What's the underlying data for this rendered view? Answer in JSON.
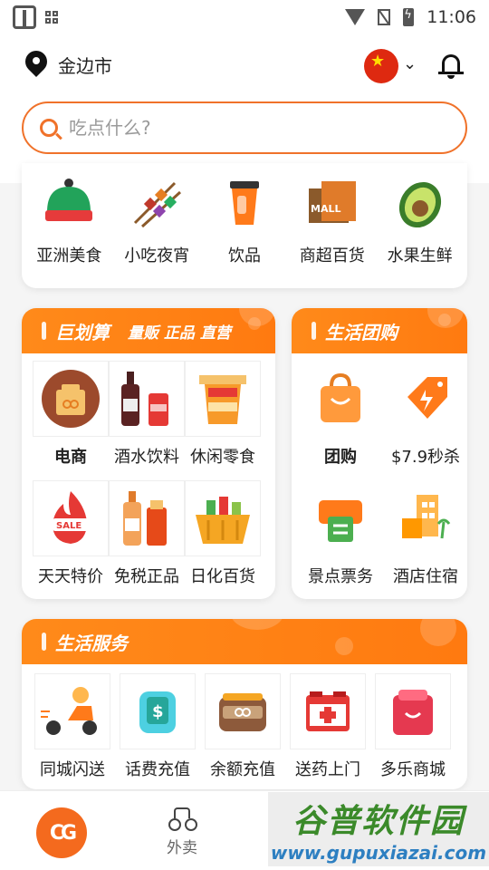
{
  "status_bar": {
    "time": "11:06"
  },
  "header": {
    "city": "金边市",
    "search_placeholder": "吃点什么?"
  },
  "categories": [
    {
      "label": "亚洲美食",
      "icon": "dish-cover-icon"
    },
    {
      "label": "小吃夜宵",
      "icon": "skewers-icon"
    },
    {
      "label": "饮品",
      "icon": "drink-cup-icon"
    },
    {
      "label": "商超百货",
      "icon": "mall-icon",
      "icon_text": "MALL"
    },
    {
      "label": "水果生鲜",
      "icon": "avocado-icon"
    }
  ],
  "promo": {
    "title": "巨划算",
    "subtitle": "量贩 正品 直营",
    "items": [
      {
        "label": "电商",
        "bold": true,
        "icon": "ecommerce-bag-icon"
      },
      {
        "label": "酒水饮料",
        "bold": false,
        "icon": "wine-bottle-icon"
      },
      {
        "label": "休闲零食",
        "bold": false,
        "icon": "noodles-icon"
      },
      {
        "label": "天天特价",
        "bold": false,
        "icon": "sale-flame-icon",
        "icon_text": "SALE"
      },
      {
        "label": "免税正品",
        "bold": false,
        "icon": "duty-free-bottles-icon"
      },
      {
        "label": "日化百货",
        "bold": false,
        "icon": "shopping-basket-icon"
      }
    ]
  },
  "group": {
    "title": "生活团购",
    "items": [
      {
        "label": "团购",
        "bold": true,
        "icon": "shopping-bag-icon"
      },
      {
        "label": "$7.9秒杀",
        "bold": false,
        "icon": "flash-tag-icon"
      },
      {
        "label": "景点票务",
        "bold": false,
        "icon": "ticket-icon"
      },
      {
        "label": "酒店住宿",
        "bold": false,
        "icon": "hotel-icon"
      }
    ]
  },
  "services": {
    "title": "生活服务",
    "items": [
      {
        "label": "同城闪送",
        "icon": "scooter-icon"
      },
      {
        "label": "话费充值",
        "icon": "phone-topup-icon",
        "icon_text": "$"
      },
      {
        "label": "余额充值",
        "icon": "wallet-icon"
      },
      {
        "label": "送药上门",
        "icon": "medicine-kit-icon"
      },
      {
        "label": "多乐商城",
        "icon": "gift-bag-icon"
      }
    ]
  },
  "bottom_nav": [
    {
      "label": "",
      "icon": "home-logo-icon"
    },
    {
      "label": "外卖",
      "icon": "delivery-bike-icon"
    }
  ],
  "watermark": {
    "line1": "谷普软件园",
    "line2": "www.gupuxiazai.com"
  },
  "colors": {
    "accent": "#f0722a",
    "banner": "#ff8a1a"
  }
}
